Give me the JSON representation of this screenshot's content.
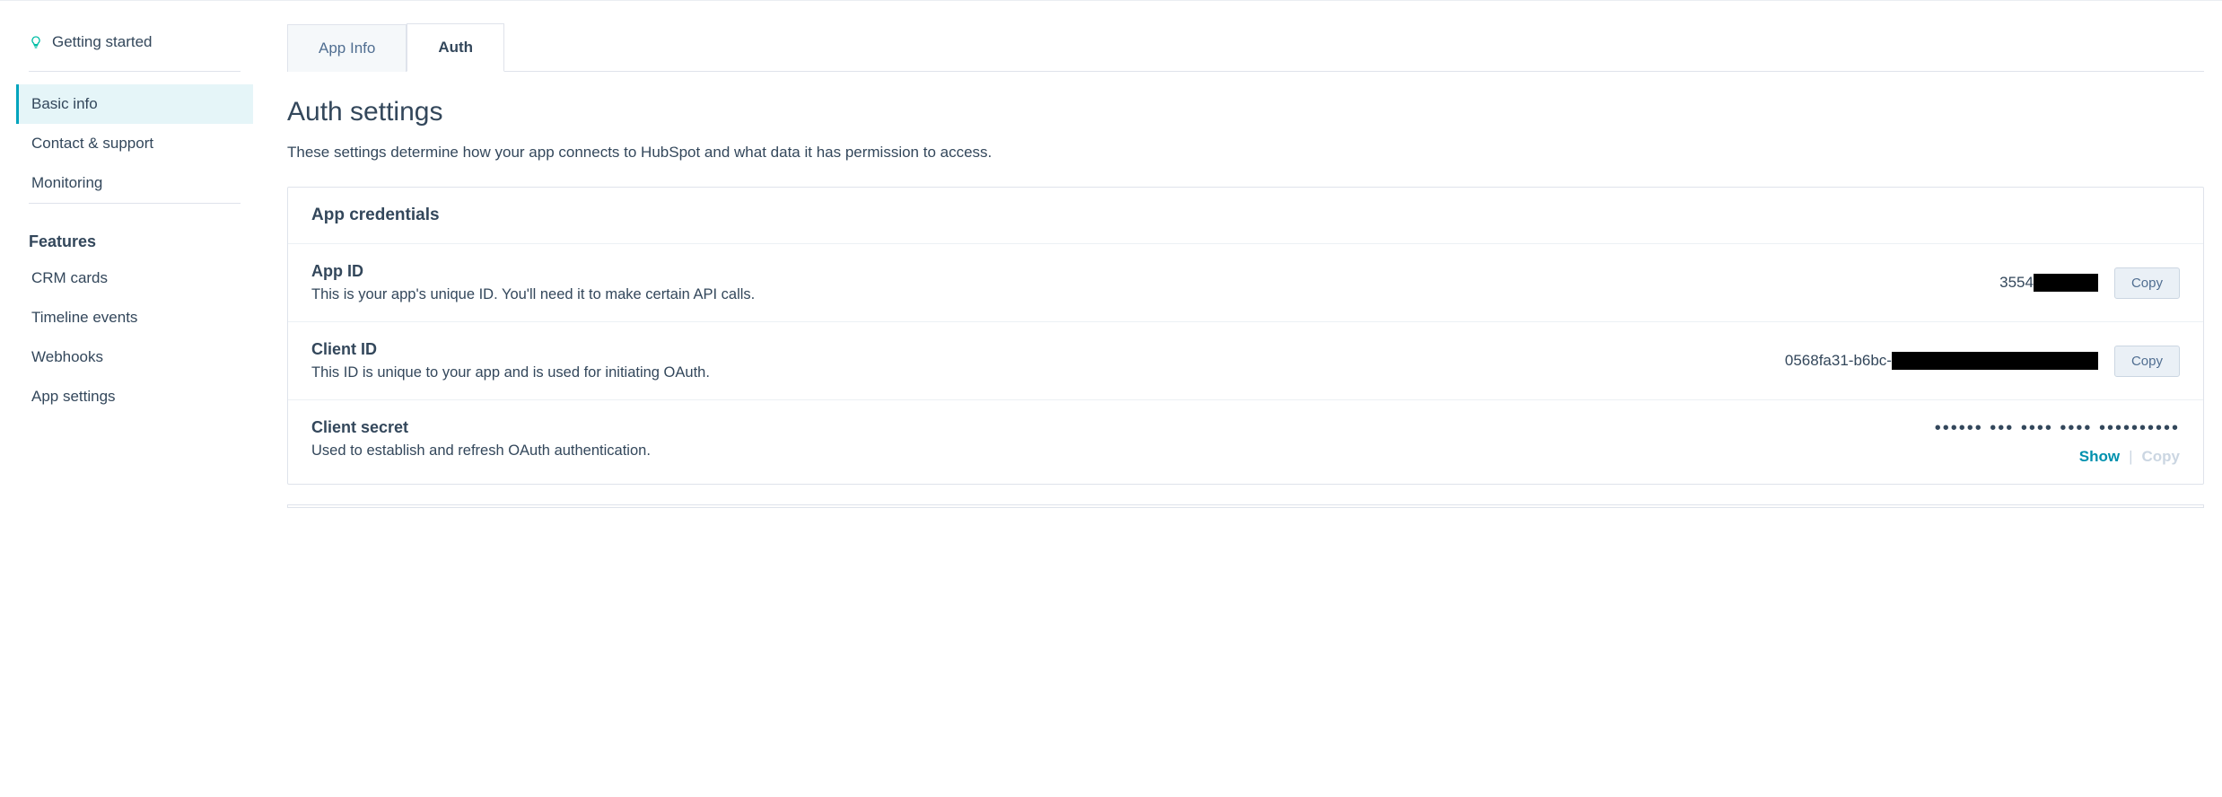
{
  "sidebar": {
    "getting_started": "Getting started",
    "items1": [
      {
        "label": "Basic info",
        "active": true
      },
      {
        "label": "Contact & support",
        "active": false
      },
      {
        "label": "Monitoring",
        "active": false
      }
    ],
    "features_heading": "Features",
    "features": [
      {
        "label": "CRM cards"
      },
      {
        "label": "Timeline events"
      },
      {
        "label": "Webhooks"
      },
      {
        "label": "App settings"
      }
    ]
  },
  "tabs": [
    {
      "label": "App Info",
      "active": false
    },
    {
      "label": "Auth",
      "active": true
    }
  ],
  "page": {
    "title": "Auth settings",
    "description": "These settings determine how your app connects to HubSpot and what data it has permission to access."
  },
  "credentials": {
    "heading": "App credentials",
    "app_id": {
      "title": "App ID",
      "desc": "This is your app's unique ID. You'll need it to make certain API calls.",
      "value_prefix": "3554",
      "copy": "Copy"
    },
    "client_id": {
      "title": "Client ID",
      "desc": "This ID is unique to your app and is used for initiating OAuth.",
      "value_prefix": "0568fa31-b6bc-",
      "copy": "Copy"
    },
    "client_secret": {
      "title": "Client secret",
      "desc": "Used to establish and refresh OAuth authentication.",
      "masked": "•••••• ••• •••• •••• ••••••••••",
      "show": "Show",
      "copy": "Copy"
    }
  }
}
